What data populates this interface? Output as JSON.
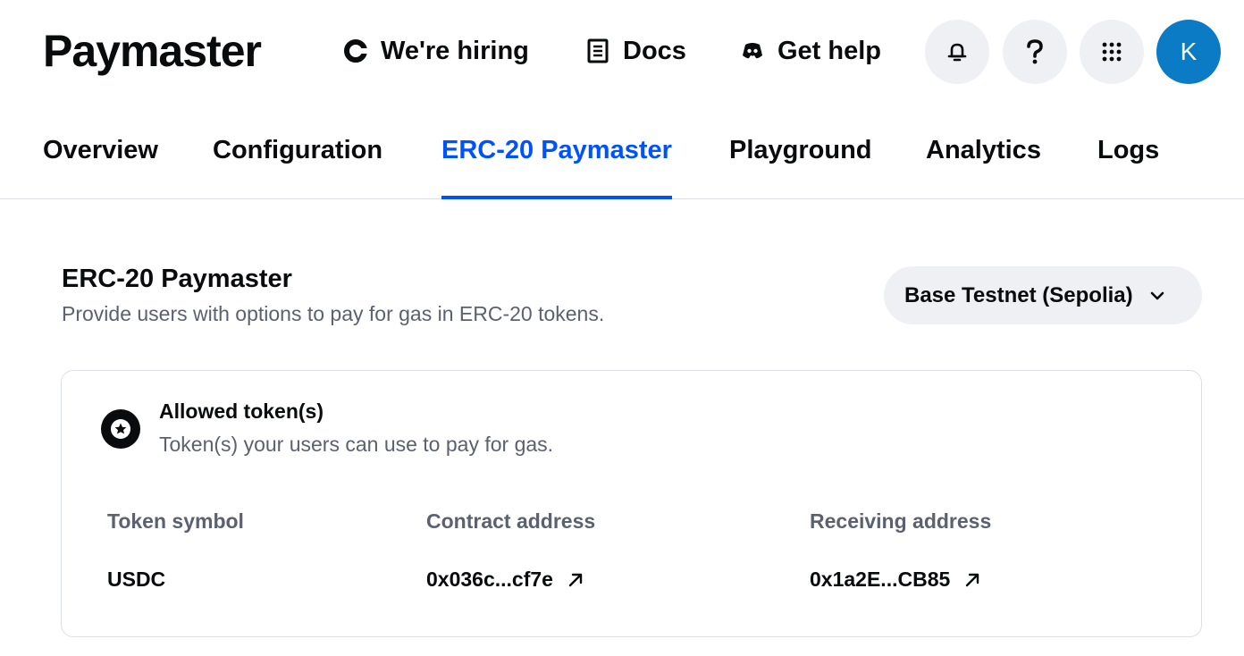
{
  "header": {
    "logo": "Paymaster",
    "links": [
      {
        "label": "We're hiring",
        "icon": "coinbase-c-icon"
      },
      {
        "label": "Docs",
        "icon": "document-icon"
      },
      {
        "label": "Get help",
        "icon": "discord-icon"
      }
    ],
    "icon_buttons": [
      "bell-icon",
      "question-icon",
      "apps-grid-icon"
    ],
    "avatar_initial": "K",
    "avatar_color": "#0a7bc4"
  },
  "tabs": [
    {
      "label": "Overview",
      "active": false
    },
    {
      "label": "Configuration",
      "active": false
    },
    {
      "label": "ERC-20 Paymaster",
      "active": true
    },
    {
      "label": "Playground",
      "active": false
    },
    {
      "label": "Analytics",
      "active": false
    },
    {
      "label": "Logs",
      "active": false
    }
  ],
  "section": {
    "title": "ERC-20 Paymaster",
    "subtitle": "Provide users with options to pay for gas in ERC-20 tokens."
  },
  "network_select": {
    "value": "Base Testnet (Sepolia)"
  },
  "card": {
    "title": "Allowed token(s)",
    "subtitle": "Token(s) your users can use to pay for gas.",
    "columns": [
      "Token symbol",
      "Contract address",
      "Receiving address"
    ],
    "rows": [
      {
        "symbol": "USDC",
        "contract": "0x036c...cf7e",
        "receiving": "0x1a2E...CB85"
      }
    ]
  },
  "colors": {
    "accent": "#0052ff",
    "muted_text": "#5b616e",
    "button_bg": "#eef0f3"
  }
}
